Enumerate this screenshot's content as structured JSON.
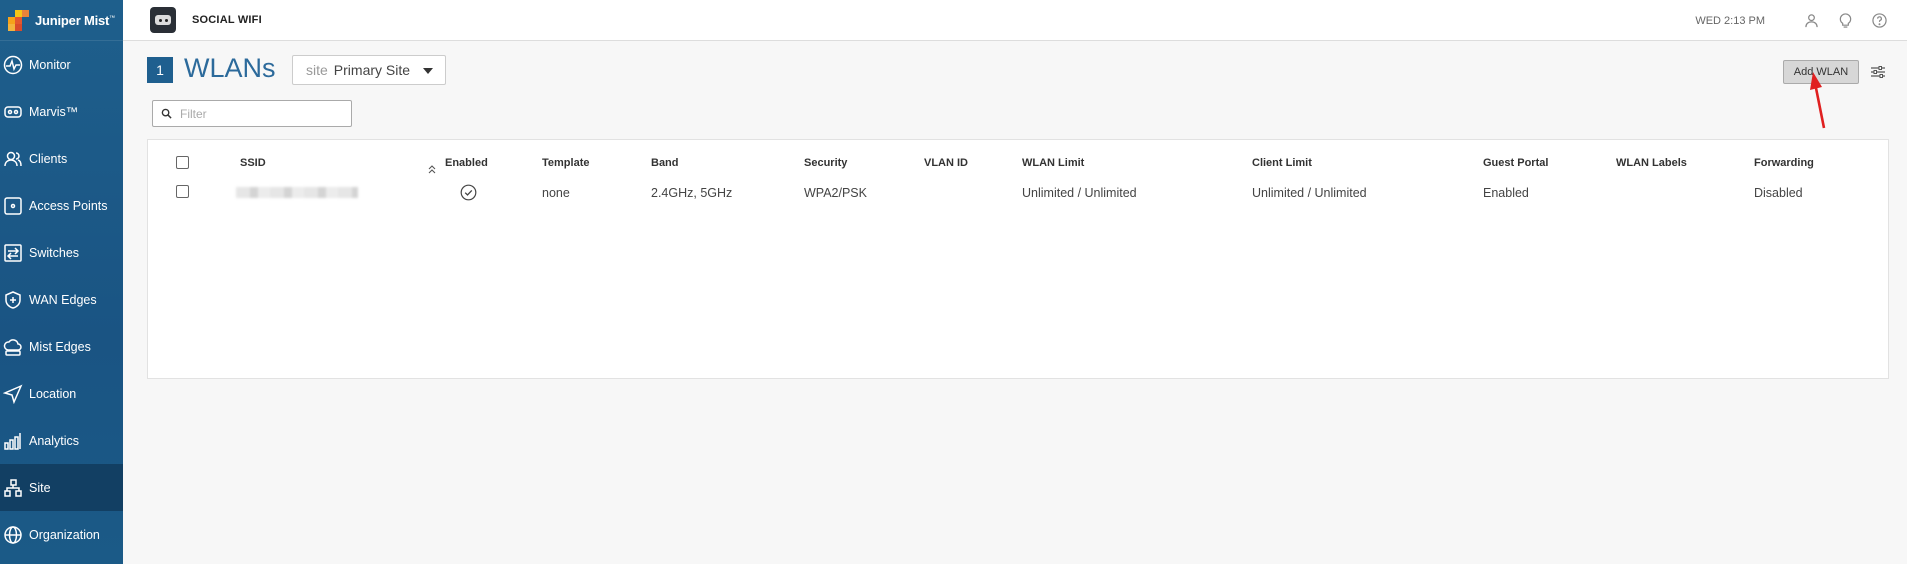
{
  "app": {
    "logo_text": "Juniper Mist",
    "logo_tm": "™",
    "org_name": "SOCIAL WIFI",
    "time": "WED 2:13 PM"
  },
  "sidebar": {
    "items": [
      {
        "label": "Monitor",
        "icon": "monitor-icon"
      },
      {
        "label": "Marvis™",
        "icon": "marvis-icon"
      },
      {
        "label": "Clients",
        "icon": "clients-icon"
      },
      {
        "label": "Access Points",
        "icon": "access-point-icon"
      },
      {
        "label": "Switches",
        "icon": "switch-icon"
      },
      {
        "label": "WAN Edges",
        "icon": "wan-edge-icon"
      },
      {
        "label": "Mist Edges",
        "icon": "mist-edge-icon"
      },
      {
        "label": "Location",
        "icon": "location-icon"
      },
      {
        "label": "Analytics",
        "icon": "analytics-icon"
      },
      {
        "label": "Site",
        "icon": "site-icon",
        "active": true
      },
      {
        "label": "Organization",
        "icon": "organization-icon"
      }
    ]
  },
  "page": {
    "count": "1",
    "title": "WLANs",
    "site_label": "site",
    "site_value": "Primary Site",
    "filter_placeholder": "Filter",
    "add_button": "Add WLAN"
  },
  "table": {
    "headers": [
      "SSID",
      "Enabled",
      "Template",
      "Band",
      "Security",
      "VLAN ID",
      "WLAN Limit",
      "Client Limit",
      "Guest Portal",
      "WLAN Labels",
      "Forwarding"
    ],
    "rows": [
      {
        "ssid": "",
        "enabled": true,
        "template": "none",
        "band": "2.4GHz, 5GHz",
        "security": "WPA2/PSK",
        "vlan_id": "",
        "wlan_limit": "Unlimited / Unlimited",
        "client_limit": "Unlimited / Unlimited",
        "guest_portal": "Enabled",
        "wlan_labels": "",
        "forwarding": "Disabled"
      }
    ]
  },
  "colors": {
    "sidebar": "#1e5f8c",
    "sidebar_active": "#123f63",
    "accent": "#2c6a9b",
    "annotation_arrow": "#e02020"
  }
}
